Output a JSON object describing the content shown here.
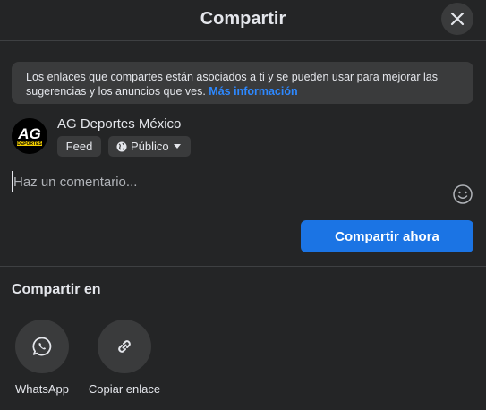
{
  "header": {
    "title": "Compartir"
  },
  "notice": {
    "text": "Los enlaces que compartes están asociados a ti y se pueden usar para mejorar las sugerencias y los anuncios que ves. ",
    "link": "Más información"
  },
  "profile": {
    "name": "AG Deportes México",
    "logo_text": "AG",
    "logo_subtext": "DEPORTES"
  },
  "audience": {
    "destination": "Feed",
    "privacy": "Público"
  },
  "comment": {
    "placeholder": "Haz un comentario..."
  },
  "actions": {
    "share_now": "Compartir ahora"
  },
  "share_in": {
    "title": "Compartir en",
    "options": [
      {
        "label": "WhatsApp",
        "icon": "whatsapp-icon"
      },
      {
        "label": "Copiar enlace",
        "icon": "link-icon"
      }
    ]
  },
  "colors": {
    "background": "#242526",
    "surface": "#3a3b3c",
    "accent": "#1b74e4",
    "link": "#2d88ff"
  }
}
